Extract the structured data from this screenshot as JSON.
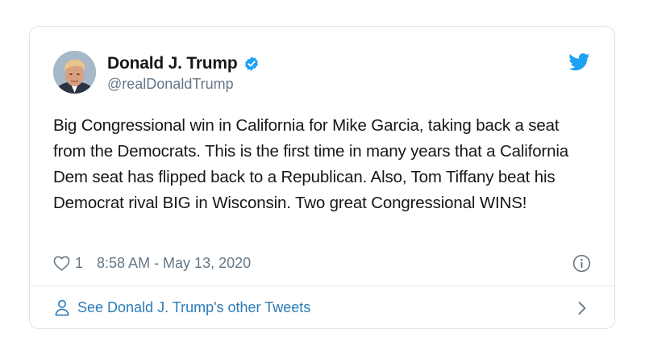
{
  "tweet": {
    "author_name": "Donald J. Trump",
    "handle": "@realDonaldTrump",
    "verified": true,
    "text": "Big Congressional win in California for Mike Garcia, taking back a seat from the Democrats. This is the first time in many years that a California Dem seat has flipped back to a Republican. Also, Tom Tiffany beat his Democrat rival BIG in Wisconsin. Two great Congressional WINS!",
    "like_count": "1",
    "timestamp": "8:58 AM - May 13, 2020"
  },
  "footer": {
    "link_label": "See Donald J. Trump's other Tweets"
  },
  "icons": {
    "platform": "twitter-bird-icon",
    "verified": "verified-badge-icon",
    "like": "heart-icon",
    "info": "info-icon",
    "profile": "person-icon",
    "chevron": "chevron-right-icon"
  },
  "colors": {
    "twitter_blue": "#1da1f2",
    "link_blue": "#2b7bb9",
    "text_primary": "#14171a",
    "text_secondary": "#657786",
    "border": "#e1e8ed"
  }
}
